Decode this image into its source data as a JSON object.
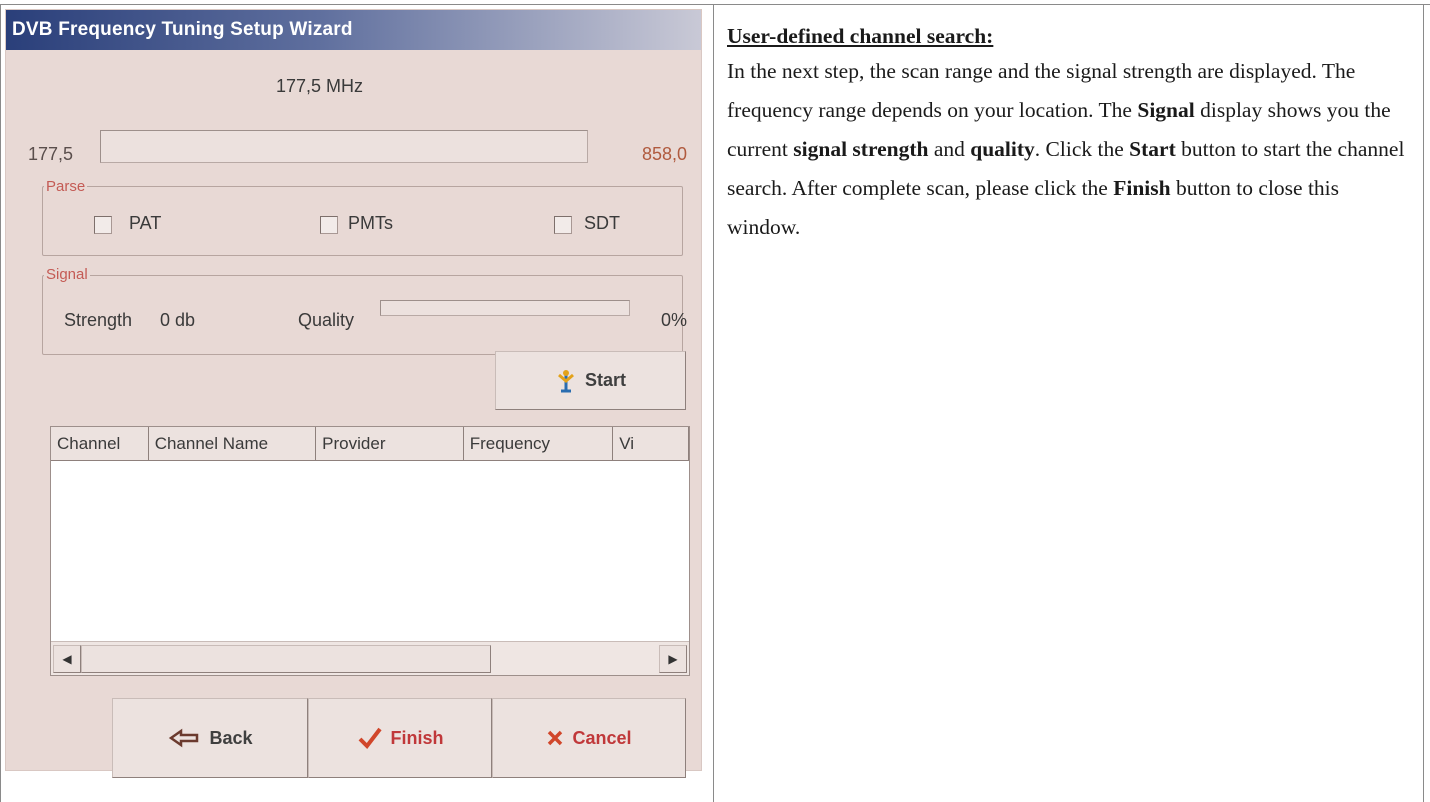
{
  "wizard": {
    "title": "DVB Frequency Tuning Setup Wizard",
    "current_frequency": "177,5 MHz",
    "range_min": "177,5",
    "range_max": "858,0",
    "parse": {
      "label": "Parse",
      "options": [
        {
          "label": "PAT",
          "checked": false
        },
        {
          "label": "PMTs",
          "checked": false
        },
        {
          "label": "SDT",
          "checked": false
        }
      ]
    },
    "signal": {
      "label": "Signal",
      "strength_label": "Strength",
      "strength_value": "0 db",
      "quality_label": "Quality",
      "quality_value": "0%",
      "quality_fraction": 0
    },
    "start_button": "Start",
    "channel_list": {
      "columns": [
        "Channel",
        "Channel Name",
        "Provider",
        "Frequency",
        "Vi"
      ],
      "rows": []
    },
    "buttons": {
      "back": "Back",
      "finish": "Finish",
      "cancel": "Cancel"
    }
  },
  "doc": {
    "heading": "User-defined channel search:",
    "p1": "In the next step, the scan range and the signal strength are displayed. The frequency range depends on your location. The ",
    "b_signal": "Signal",
    "p2": " display shows you the current ",
    "b_strength": "signal strength",
    "p3": " and ",
    "b_quality": "quality",
    "p4": ". Click the ",
    "b_start": "Start",
    "p5": " button to start the channel search. After complete scan, please click the ",
    "b_finish": "Finish",
    "p6": " button to close this window."
  },
  "colors": {
    "window_bg": "#e8d9d5",
    "titlebar_start": "#2a3f7a",
    "group_label": "#c45b55",
    "accent_red": "#c0383a"
  }
}
